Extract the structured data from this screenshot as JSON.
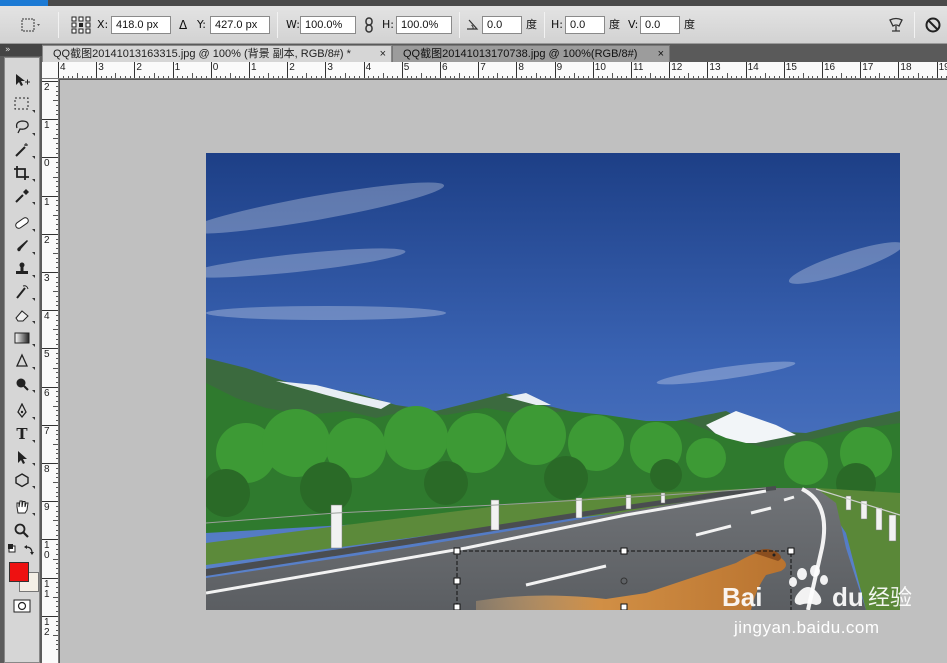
{
  "options_bar": {
    "x_label": "X:",
    "x_value": "418.0 px",
    "y_label": "Y:",
    "y_value": "427.0 px",
    "w_label": "W:",
    "w_value": "100.0%",
    "h_label": "H:",
    "h_value": "100.0%",
    "angle_value": "0.0",
    "angle_unit": "度",
    "hskew_label": "H:",
    "hskew_value": "0.0",
    "hskew_unit": "度",
    "vskew_label": "V:",
    "vskew_value": "0.0",
    "vskew_unit": "度"
  },
  "tabs": [
    {
      "label": "QQ截图20141013163315.jpg @ 100% (背景 副本, RGB/8#) *",
      "close": "×"
    },
    {
      "label": "QQ截图20141013170738.jpg @ 100%(RGB/8#)",
      "close": "×"
    }
  ],
  "ruler_top": {
    "labels": [
      "4",
      "3",
      "2",
      "1",
      "0",
      "1",
      "2",
      "3",
      "4",
      "5",
      "6",
      "7",
      "8",
      "9",
      "10",
      "11",
      "12",
      "13",
      "14",
      "15",
      "16",
      "17",
      "18",
      "19"
    ]
  },
  "ruler_left": {
    "labels": [
      "2",
      "1",
      "0",
      "1",
      "2",
      "3",
      "4",
      "5",
      "6",
      "7",
      "8",
      "9",
      "1 0",
      "1 1",
      "1 2"
    ]
  },
  "watermark": {
    "brand": "Baidu",
    "brand_cn": "经验",
    "url": "jingyan.baidu.com"
  },
  "colors": {
    "foreground": "#ee1111",
    "background": "#f4efe6",
    "tab_active": "#d6d6d6",
    "canvas_bg": "#c0c0c0"
  },
  "icons": [
    "move-tool-icon",
    "marquee-tool-icon",
    "lasso-tool-icon",
    "magic-wand-icon",
    "crop-tool-icon",
    "eyedropper-icon",
    "healing-brush-icon",
    "brush-icon",
    "clone-stamp-icon",
    "history-brush-icon",
    "eraser-icon",
    "gradient-icon",
    "blur-icon",
    "dodge-icon",
    "pen-icon",
    "type-icon",
    "path-select-icon",
    "shape-icon",
    "hand-icon",
    "zoom-icon",
    "swap-colors-icon",
    "quick-mask-icon"
  ]
}
